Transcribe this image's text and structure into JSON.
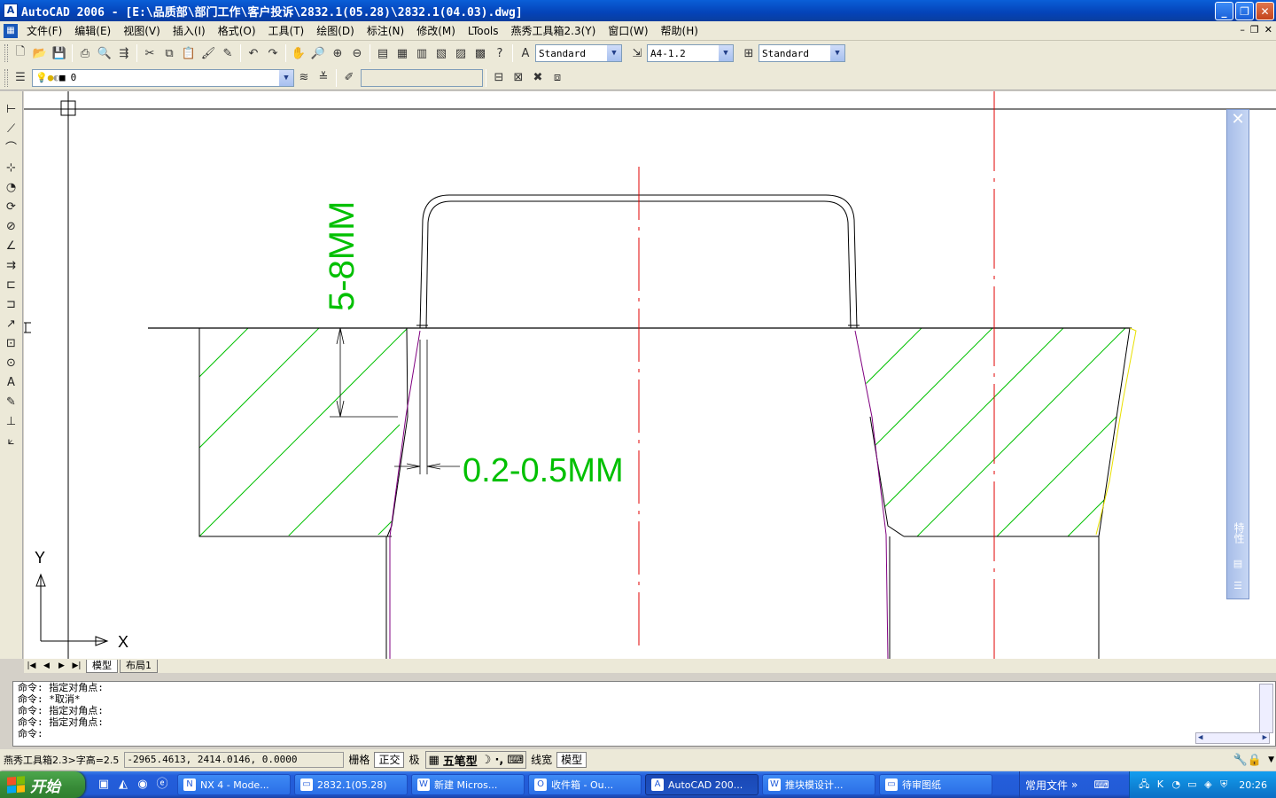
{
  "window": {
    "title": "AutoCAD 2006 - [E:\\品质部\\部门工作\\客户投诉\\2832.1(05.28)\\2832.1(04.03).dwg]",
    "minimize": "_",
    "restore": "❐",
    "close": "✕"
  },
  "menu": {
    "items": [
      "文件(F)",
      "编辑(E)",
      "视图(V)",
      "插入(I)",
      "格式(O)",
      "工具(T)",
      "绘图(D)",
      "标注(N)",
      "修改(M)",
      "LTools",
      "燕秀工具箱2.3(Y)",
      "窗口(W)",
      "帮助(H)"
    ]
  },
  "toolbar1": {
    "text_style": "Standard",
    "dim_style": "A4-1.2",
    "table_style": "Standard"
  },
  "toolbar2": {
    "layer": "0",
    "linetype_box": ""
  },
  "drawing": {
    "dim1": "5-8MM",
    "dim2": "0.2-0.5MM",
    "ucs_x": "X",
    "ucs_y": "Y"
  },
  "tabs": {
    "nav": [
      "|◀",
      "◀",
      "▶",
      "▶|"
    ],
    "model": "模型",
    "layout1": "布局1"
  },
  "command": {
    "lines": [
      "命令: 指定对角点:",
      "命令: *取消*",
      "命令: 指定对角点:",
      "命令: 指定对角点:",
      "命令:"
    ]
  },
  "status": {
    "tool": "燕秀工具箱2.3>字高=2.5",
    "coords": "-2965.4613, 2414.0146, 0.0000",
    "grid": "栅格",
    "ortho": "正交",
    "polar": "极",
    "ime_name": "五笔型",
    "lineweight": "线宽",
    "model": "模型"
  },
  "properties_palette": {
    "label": "特性"
  },
  "taskbar": {
    "start": "开始",
    "tasks": [
      {
        "label": "NX 4 - Mode...",
        "icon": "nx-icon"
      },
      {
        "label": "2832.1(05.28)",
        "icon": "folder-icon"
      },
      {
        "label": "新建 Micros...",
        "icon": "word-icon"
      },
      {
        "label": "收件箱 - Ou...",
        "icon": "outlook-icon"
      },
      {
        "label": "AutoCAD 200...",
        "icon": "autocad-icon"
      },
      {
        "label": "推块模设计...",
        "icon": "doc-icon"
      },
      {
        "label": "待审图纸",
        "icon": "folder-icon"
      }
    ],
    "common_files": "常用文件",
    "clock": "20:26"
  },
  "colors": {
    "titlebar": "#0a5fd8",
    "hatch": "#00c000",
    "dimension": "#00c000",
    "centerline": "#e00000",
    "outline": "#000000",
    "taper": "#800080"
  }
}
